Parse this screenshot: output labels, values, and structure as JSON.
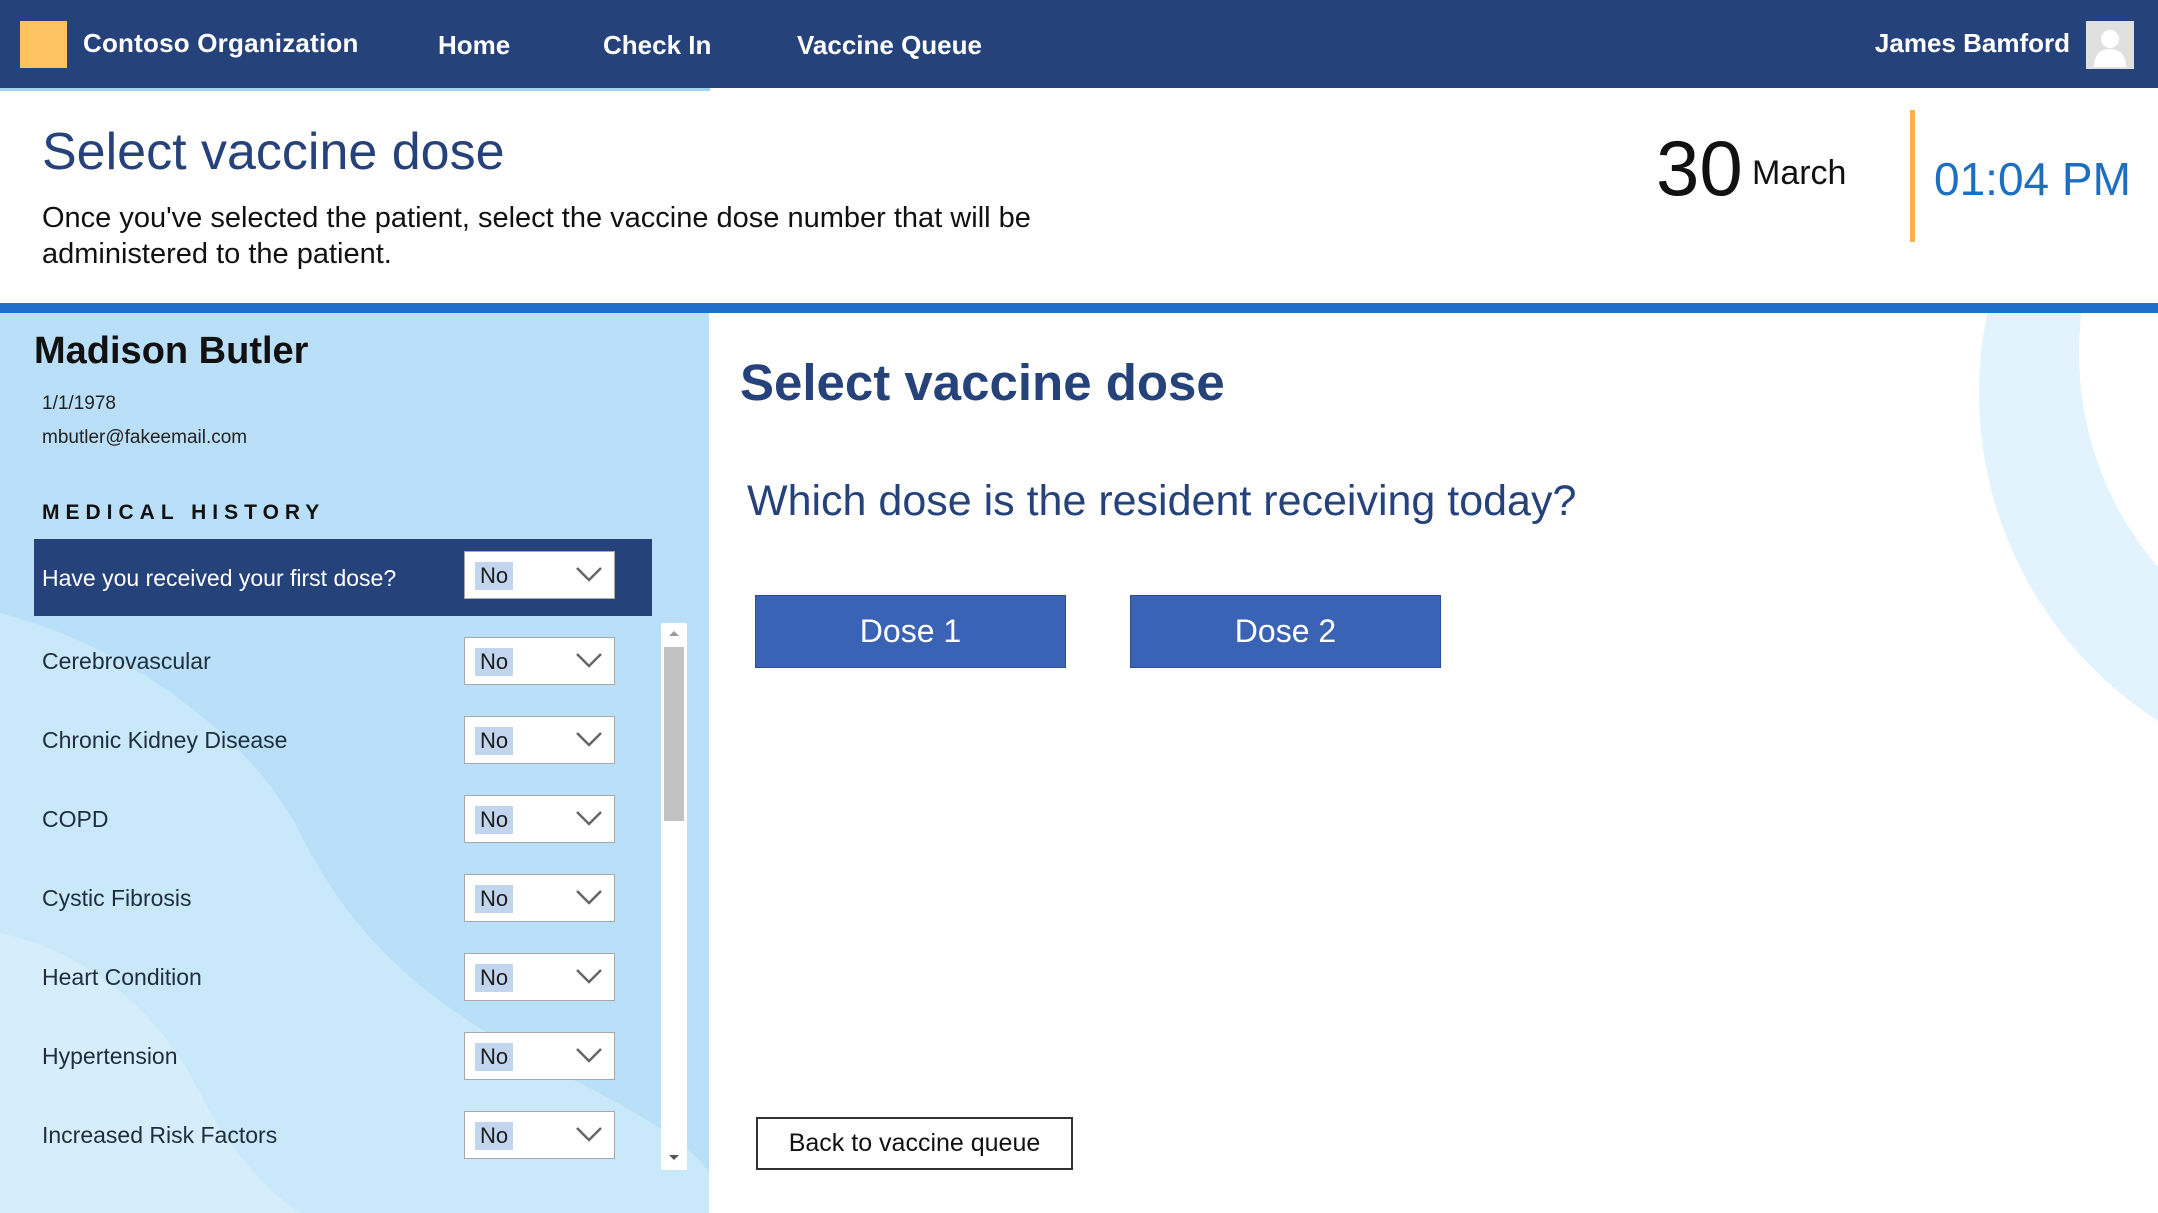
{
  "nav": {
    "org_name": "Contoso Organization",
    "links": [
      "Home",
      "Check In",
      "Vaccine Queue"
    ],
    "user_name": "James Bamford",
    "logo_color": "#ffc261",
    "bar_color": "#26427a"
  },
  "header": {
    "title": "Select vaccine dose",
    "description": "Once you've selected the patient, select the vaccine dose number that will be administered to the patient.",
    "date_day": "30",
    "date_month": "March",
    "time": "01:04 PM"
  },
  "patient": {
    "name": "Madison Butler",
    "dob": "1/1/1978",
    "email": "mbutler@fakeemail.com"
  },
  "medical_history": {
    "title": "MEDICAL HISTORY",
    "items": [
      {
        "label": "Have you received your first dose?",
        "value": "No"
      },
      {
        "label": "Cerebrovascular",
        "value": "No"
      },
      {
        "label": "Chronic Kidney Disease",
        "value": "No"
      },
      {
        "label": "COPD",
        "value": "No"
      },
      {
        "label": "Cystic Fibrosis",
        "value": "No"
      },
      {
        "label": "Heart Condition",
        "value": "No"
      },
      {
        "label": "Hypertension",
        "value": "No"
      },
      {
        "label": "Increased Risk Factors",
        "value": "No"
      }
    ]
  },
  "main": {
    "title": "Select vaccine dose",
    "question": "Which dose is the resident receiving today?",
    "dose_buttons": [
      "Dose 1",
      "Dose 2"
    ],
    "back_label": "Back to vaccine queue",
    "accent_color": "#3a63b5"
  }
}
